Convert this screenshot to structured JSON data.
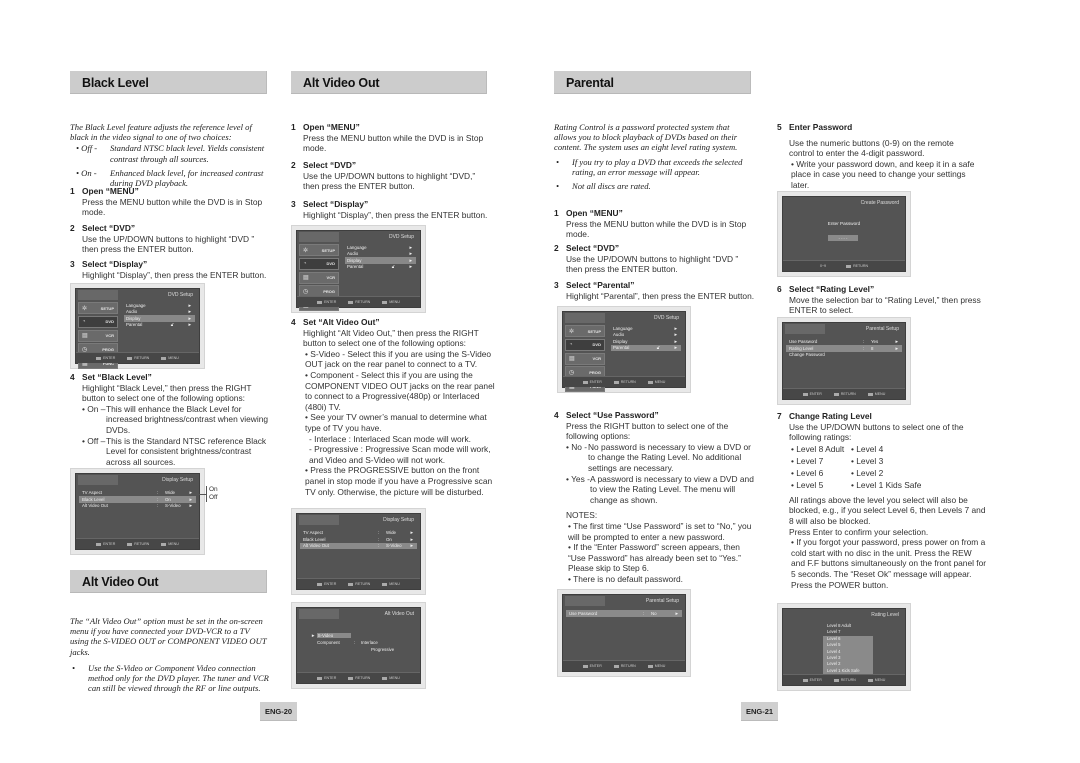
{
  "left_page": {
    "black_level": {
      "heading": "Black Level",
      "intro": "The Black Level feature adjusts the reference level of black in the video signal to one of two choices:",
      "choices": [
        {
          "key": "• Off -",
          "text": "Standard NTSC black level. Yields consistent contrast through all sources."
        },
        {
          "key": "• On -",
          "text": "Enhanced black level, for increased contrast during DVD playback."
        }
      ],
      "steps": [
        {
          "num": "1",
          "title": "Open “MENU”",
          "body": "Press the MENU button while the DVD is in Stop mode."
        },
        {
          "num": "2",
          "title": "Select “DVD”",
          "body": "Use the UP/DOWN buttons to highlight “DVD ” then press the ENTER button."
        },
        {
          "num": "3",
          "title": "Select “Display”",
          "body": "Highlight “Display”, then press the ENTER button."
        },
        {
          "num": "4",
          "title": "Set “Black Level”",
          "body": "Highlight “Black Level,” then press the RIGHT button to select one of the following options:",
          "options": [
            {
              "key": "• On –",
              "text": "This will enhance the Black Level for increased brightness/contrast when viewing DVDs."
            },
            {
              "key": "• Off –",
              "text": "This is the Standard NTSC reference Black Level for consistent brightness/contrast across all sources."
            }
          ]
        }
      ],
      "callout_on": "On",
      "callout_off": "Off"
    },
    "alt_video_out_intro": {
      "heading": "Alt Video Out",
      "intro": "The “Alt  Video Out” option must be set in the on-screen menu if you have connected your DVD-VCR to a TV using the S-VIDEO OUT or COMPONENT VIDEO OUT jacks.",
      "bullet": "Use the S-Video or Component Video connection method only for the DVD player. The tuner and VCR can still be viewed through the RF or line outputs."
    },
    "alt_video_out": {
      "heading": "Alt Video Out",
      "steps": [
        {
          "num": "1",
          "title": "Open “MENU”",
          "body": "Press the MENU button while the DVD is in Stop mode."
        },
        {
          "num": "2",
          "title": "Select “DVD”",
          "body": "Use the UP/DOWN buttons to highlight “DVD,” then press the ENTER button."
        },
        {
          "num": "3",
          "title": "Select “Display”",
          "body": "Highlight “Display”, then press the ENTER button."
        },
        {
          "num": "4",
          "title": "Set “Alt Video Out”",
          "body": "Highlight “Alt Video Out,” then press the RIGHT button to select one of the following options:",
          "bullets": [
            "• S-Video - Select this if you are using the S-Video OUT jack on the rear panel to connect to a TV.",
            "• Component - Select this if you are using the COMPONENT VIDEO OUT jacks on the rear panel to connect to a Progressive(480p) or Interlaced (480i) TV.",
            "• See your TV owner’s manual to determine what type of TV you have.",
            "- Interlace : Interlaced Scan mode will work.",
            "- Progressive : Progressive Scan mode will work, and Video and S-Video will not work.",
            "• Press the PROGRESSIVE button on the front panel in stop mode if you have a Progressive scan TV only. Otherwise, the picture will be disturbed."
          ]
        }
      ]
    },
    "page_number": "ENG-20"
  },
  "right_page": {
    "parental": {
      "heading": "Parental",
      "intro": "Rating Control is a password protected system that allows you to block playback of DVDs based on their content. The system uses an eight level rating system.",
      "bullets": [
        "If you try to play a DVD that exceeds the selected rating, an error message will appear.",
        "Not all discs are rated."
      ],
      "steps": [
        {
          "num": "1",
          "title": "Open “MENU”",
          "body": "Press the MENU button while the DVD is in Stop mode."
        },
        {
          "num": "2",
          "title": "Select “DVD”",
          "body": "Use the UP/DOWN buttons to highlight “DVD ” then press the ENTER button."
        },
        {
          "num": "3",
          "title": "Select “Parental”",
          "body": "Highlight “Parental”, then press the ENTER button."
        },
        {
          "num": "4",
          "title": "Select “Use Password”",
          "body": "Press the RIGHT button to select one of the following options:",
          "options": [
            {
              "key": "• No -",
              "text": "No password is necessary to view a DVD or to change the  Rating Level. No additional settings are necessary."
            },
            {
              "key": "• Yes -",
              "text": "A password is necessary to view a DVD and to view the Rating Level. The menu will change as shown."
            }
          ],
          "notes_label": "NOTES:",
          "notes": [
            "• The first time “Use Password” is set to “No,” you will be prompted to enter a new password.",
            "• If the “Enter Password” screen appears, then “Use Password” has already been set to “Yes.” Please skip to Step 6.",
            "• There is no default password."
          ]
        }
      ]
    },
    "steps_right": [
      {
        "num": "5",
        "title": "Enter Password",
        "body": "Use the numeric buttons (0-9) on the remote control to enter the 4-digit password.",
        "bullet": "• Write your password down, and keep it in a safe place in case you need to change your settings later."
      },
      {
        "num": "6",
        "title": "Select “Rating Level”",
        "body": "Move the selection bar to “Rating Level,” then press ENTER to select."
      },
      {
        "num": "7",
        "title": "Change Rating Level",
        "body": "Use the UP/DOWN buttons to select one of the following ratings:",
        "ratings_col1": [
          "• Level 8 Adult",
          "• Level 7",
          "• Level 6",
          "• Level 5"
        ],
        "ratings_col2": [
          "• Level 4",
          "• Level 3",
          "• Level 2",
          "• Level 1 Kids Safe"
        ],
        "after": "All ratings above the level you select will also be blocked, e.g., if you select Level 6, then Levels 7 and 8 will also be blocked.",
        "confirm": "Press Enter to confirm your selection.",
        "bullet": "• If you forgot your password, press power on from a cold start with no disc in the unit. Press the REW and F.F buttons simultaneously on the front panel for 5 seconds. The “Reset Ok” message will appear. Press the POWER button."
      }
    ],
    "page_number": "ENG-21"
  },
  "screens": {
    "dvd_setup": {
      "title": "DVD Setup",
      "side": [
        "SETUP",
        "DVD",
        "VCR",
        "PROG",
        "FUNC"
      ],
      "items": [
        "Language",
        "Audio",
        "Display",
        "Parental"
      ]
    },
    "display_setup": {
      "title": "Display Setup",
      "rows": [
        {
          "label": "TV Aspect",
          "value": "Wide"
        },
        {
          "label": "Black Level",
          "value": "On"
        },
        {
          "label": "Alt Video Out",
          "value": "S-Video"
        }
      ]
    },
    "alt_video_out": {
      "title": "Alt Video Out",
      "items": [
        "S-Video",
        "Component",
        "Interlace",
        "Progressive"
      ]
    },
    "parental_setup_no": {
      "title": "Parental Setup",
      "rows": [
        {
          "label": "Use Password",
          "value": "No"
        }
      ]
    },
    "create_password": {
      "title": "Create Password",
      "prompt": "Enter Password",
      "field": "- - - -",
      "bar_left": "0~9",
      "bar_right": "RETURN"
    },
    "parental_setup_yes": {
      "title": "Parental Setup",
      "rows": [
        {
          "label": "Use Password",
          "value": "Yes"
        },
        {
          "label": "Rating Level",
          "value": "8"
        },
        {
          "label": "Change Password",
          "value": ""
        }
      ]
    },
    "rating_level": {
      "title": "Rating Level",
      "levels": [
        "Level  8  Adult",
        "Level  7",
        "Level  6",
        "Level  5",
        "Level  4",
        "Level  3",
        "Level  2",
        "Level  1  Kids Safe"
      ]
    },
    "bar": {
      "enter": "ENTER",
      "return": "RETURN",
      "menu": "MENU"
    }
  }
}
